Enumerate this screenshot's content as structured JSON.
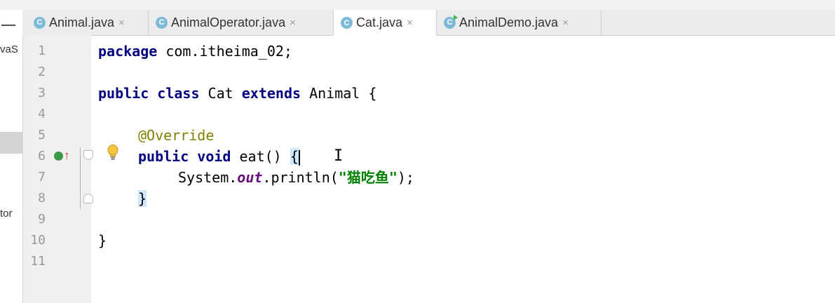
{
  "tabs": [
    {
      "label": "Animal.java",
      "active": false
    },
    {
      "label": "AnimalOperator.java",
      "active": false
    },
    {
      "label": "Cat.java",
      "active": true
    },
    {
      "label": "AnimalDemo.java",
      "active": false
    }
  ],
  "tab_icon_letter": "C",
  "tab_close_glyph": "×",
  "left_panel": {
    "fragment_top": "vaS",
    "fragment_mid": "tor"
  },
  "editor": {
    "line_numbers": [
      "1",
      "2",
      "3",
      "4",
      "5",
      "6",
      "7",
      "8",
      "9",
      "10",
      "11"
    ],
    "code": {
      "line1_kw": "package",
      "line1_rest": " com.itheima_02;",
      "line3_kw1": "public",
      "line3_kw2": "class",
      "line3_name": " Cat ",
      "line3_kw3": "extends",
      "line3_rest": " Animal {",
      "line5_ann": "@Override",
      "line6_kw1": "public",
      "line6_kw2": "void",
      "line6_rest": " eat() ",
      "line6_brace": "{",
      "line7_pre": "System.",
      "line7_field": "out",
      "line7_mid": ".println(",
      "line7_str": "\"猫吃鱼\"",
      "line7_post": ");",
      "line8_brace": "}",
      "line10_brace": "}"
    }
  },
  "colors": {
    "keyword": "#000080",
    "annotation": "#808000",
    "string": "#008000",
    "field": "#660e7a",
    "brace_highlight": "#cfe6ff"
  },
  "icons": [
    "override-indicator-icon",
    "up-arrow-icon",
    "lightbulb-icon",
    "fold-icon",
    "class-icon",
    "close-icon"
  ]
}
